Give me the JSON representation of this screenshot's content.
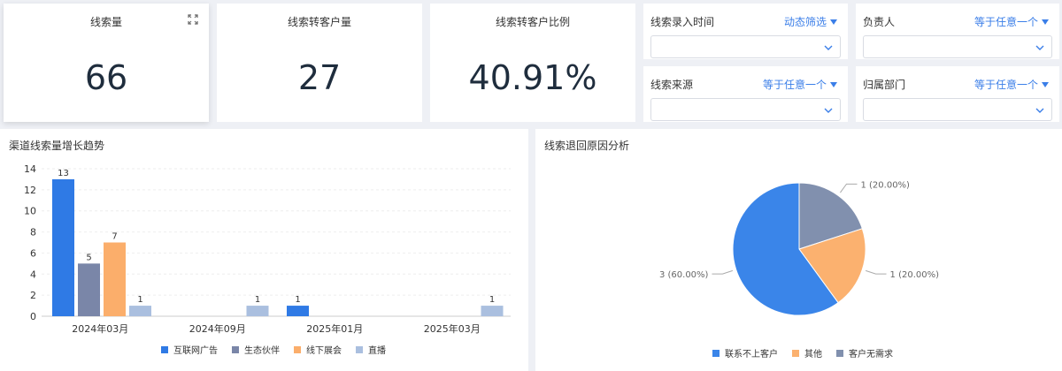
{
  "kpis": [
    {
      "title": "线索量",
      "value": "66"
    },
    {
      "title": "线索转客户量",
      "value": "27"
    },
    {
      "title": "线索转客户比例",
      "value": "40.91%"
    }
  ],
  "filters": [
    {
      "label": "线索录入时间",
      "mode": "动态筛选"
    },
    {
      "label": "负责人",
      "mode": "等于任意一个"
    },
    {
      "label": "线索来源",
      "mode": "等于任意一个"
    },
    {
      "label": "归属部门",
      "mode": "等于任意一个"
    }
  ],
  "icons": {
    "expand": "expand-icon",
    "caret": "caret-down-icon",
    "chevron": "chevron-down-icon"
  },
  "colors": {
    "accent": "#3a7ee8"
  },
  "bar_panel": {
    "title": "渠道线索量增长趋势"
  },
  "pie_panel": {
    "title": "线索退回原因分析"
  },
  "chart_data": [
    {
      "type": "bar",
      "categories": [
        "2024年03月",
        "2024年09月",
        "2025年01月",
        "2025年03月"
      ],
      "series": [
        {
          "name": "互联网广告",
          "color": "#2f7ae5",
          "values": [
            13,
            null,
            1,
            null
          ]
        },
        {
          "name": "生态伙伴",
          "color": "#7a86a8",
          "values": [
            5,
            null,
            null,
            null
          ]
        },
        {
          "name": "线下展会",
          "color": "#fbae6b",
          "values": [
            7,
            null,
            null,
            null
          ]
        },
        {
          "name": "直播",
          "color": "#aabfdf",
          "values": [
            1,
            1,
            null,
            1
          ]
        }
      ],
      "ylim": [
        0,
        14
      ],
      "yticks": [
        0,
        2,
        4,
        6,
        8,
        10,
        12,
        14
      ],
      "grid": true,
      "legend": "bottom"
    },
    {
      "type": "pie",
      "slices": [
        {
          "name": "联系不上客户",
          "value": 3,
          "label": "3 (60.00%)",
          "color": "#3a85e9"
        },
        {
          "name": "其他",
          "value": 1,
          "label": "1 (20.00%)",
          "color": "#fbb16f"
        },
        {
          "name": "客户无需求",
          "value": 1,
          "label": "1 (20.00%)",
          "color": "#8190ae"
        }
      ],
      "legend": "bottom"
    }
  ]
}
